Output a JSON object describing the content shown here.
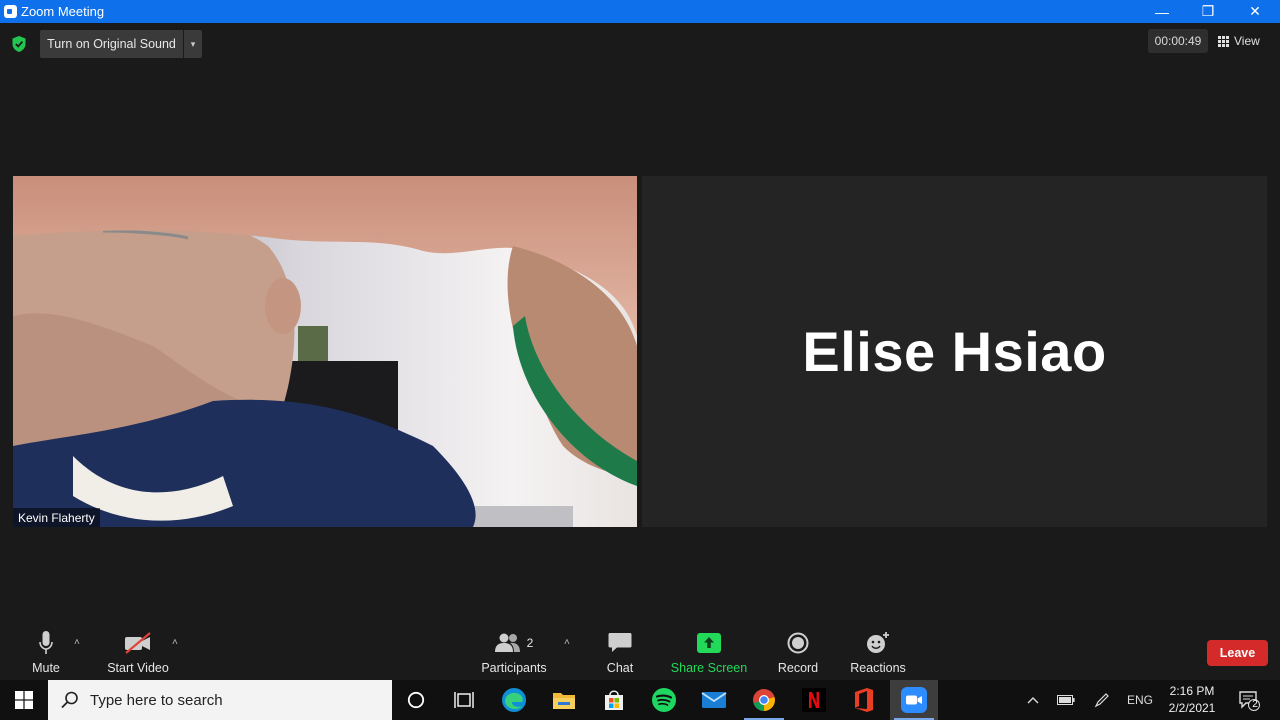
{
  "window": {
    "title": "Zoom Meeting",
    "controls": {
      "minimize": "—",
      "restore": "❒",
      "close": "✕"
    }
  },
  "top_bar": {
    "sound_button": "Turn on Original Sound",
    "dropdown_caret": "▾",
    "timer": "00:00:49",
    "view_label": "View"
  },
  "participants_tiles": [
    {
      "name": "Kevin Flaherty",
      "video": "on"
    },
    {
      "name": "Elise Hsiao",
      "video": "off"
    }
  ],
  "controls": {
    "mute": "Mute",
    "start_video": "Start Video",
    "participants": "Participants",
    "participants_count": "2",
    "chat": "Chat",
    "share_screen": "Share Screen",
    "record": "Record",
    "reactions": "Reactions",
    "leave": "Leave",
    "caret": "˄"
  },
  "taskbar": {
    "search_placeholder": "Type here to search",
    "language": "ENG",
    "time": "2:16 PM",
    "date": "2/2/2021",
    "notification_count": "2"
  },
  "colors": {
    "titlebar": "#0e71eb",
    "share_screen": "#23d959",
    "leave": "#d52a2a"
  }
}
